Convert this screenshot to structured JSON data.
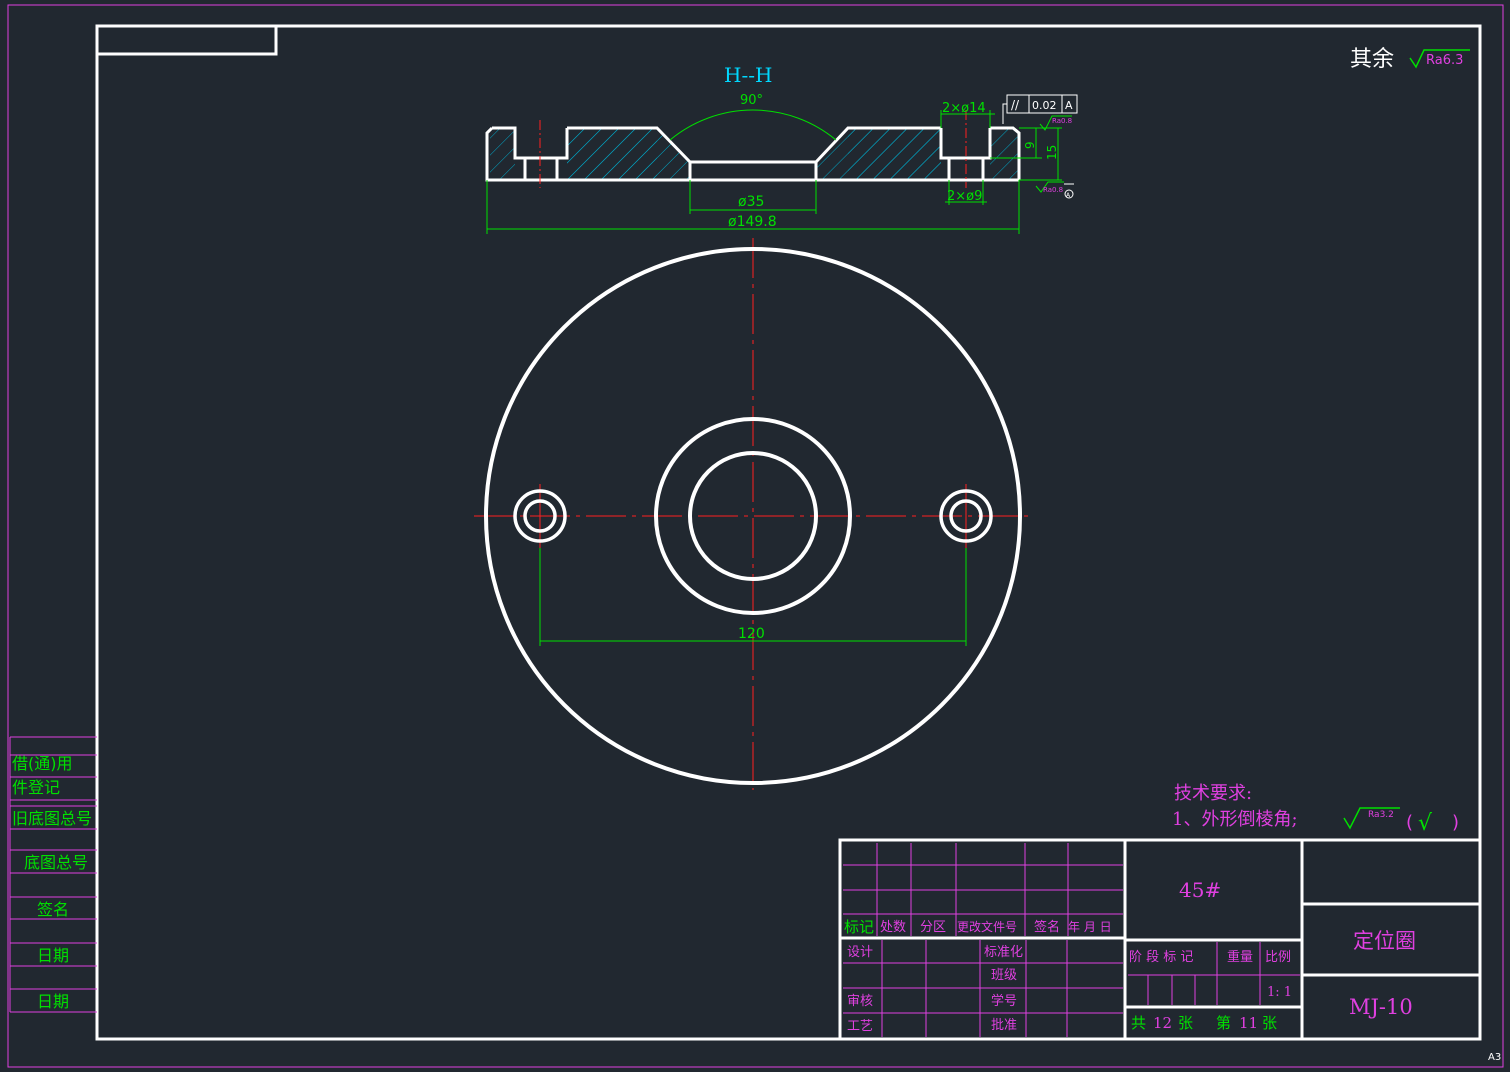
{
  "drawing": {
    "section_title": "H--H",
    "angle_label": "90°",
    "counterbore_dim": "2×ø14",
    "hole_dim": "2×ø9",
    "tolerance_symbol": "//",
    "tolerance_value": "0.02",
    "datum_letter": "A",
    "depth_dim_inner": "9",
    "depth_dim_outer": "15",
    "roughness_top": "Ra0.8",
    "roughness_bottom": "Ra0.8",
    "datum_marker": "A",
    "bore_dim": "ø35",
    "outer_dim": "ø149.8",
    "pitch_dim": "120",
    "other_roughness_prefix": "其余",
    "other_roughness_value": "Ra6.3",
    "sheet_size": "A3"
  },
  "tech_req": {
    "title": "技术要求:",
    "item1": "1、外形倒棱角;",
    "roughness": "Ra3.2",
    "paren_open": "(",
    "check": "√",
    "paren_close": ")"
  },
  "side_table": {
    "rows": [
      "借(通)用",
      "件登记",
      "旧底图总号",
      "底图总号",
      "签名",
      "日期",
      "日期"
    ]
  },
  "title_block": {
    "material": "45#",
    "part_name": "定位圈",
    "part_code": "MJ-10",
    "revision_headers": [
      "标记",
      "处数",
      "分区",
      "更改文件号",
      "签名",
      "年 月 日"
    ],
    "sign_left": [
      "设计",
      "审核",
      "工艺"
    ],
    "sign_right": [
      "标准化",
      "班级",
      "学号",
      "批准"
    ],
    "stage_headers": [
      "阶 段 标 记",
      "重量",
      "比例"
    ],
    "scale": "1: 1",
    "total_prefix": "共",
    "total_sheets": "12",
    "total_suffix": "张",
    "sheet_prefix": "第",
    "sheet_number": "11",
    "sheet_suffix": "张"
  },
  "colors": {
    "background": "#212830",
    "outline": "#ffffff",
    "dimension": "#00e000",
    "centerline": "#ff2020",
    "hatch": "#00a8c8",
    "annotation": "#e040e0",
    "title_text": "#00d8ff"
  }
}
